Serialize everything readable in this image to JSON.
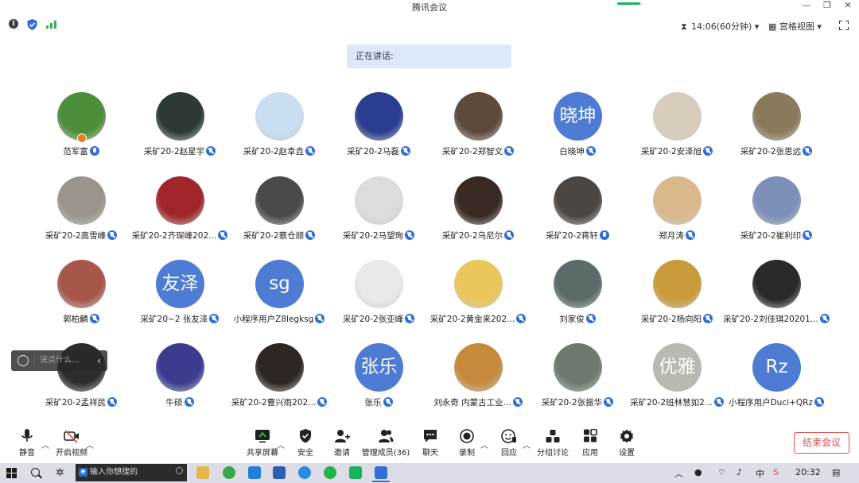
{
  "window": {
    "title": "腾讯会议",
    "controls": [
      "—",
      "❐",
      "✕"
    ],
    "progress_fraction": 0.9
  },
  "topbar": {
    "timer": "14:06(60分钟)",
    "view_mode": "宫格视图"
  },
  "speaking_label": "正在讲话:",
  "participants": [
    {
      "name": "范军富",
      "avatar_text": "",
      "color": "#4d8e3b",
      "host": true,
      "mic": "on"
    },
    {
      "name": "采矿20-2赵星宇",
      "avatar_text": "",
      "color": "#2c3a33",
      "host": false,
      "mic": "off"
    },
    {
      "name": "采矿20-2赵幸垚",
      "avatar_text": "",
      "color": "#c9def0",
      "host": false,
      "mic": "off"
    },
    {
      "name": "采矿20-2马磊",
      "avatar_text": "",
      "color": "#2a3d8f",
      "host": false,
      "mic": "off"
    },
    {
      "name": "采矿20-2郑智文",
      "avatar_text": "",
      "color": "#5e4a3c",
      "host": false,
      "mic": "off"
    },
    {
      "name": "白晓坤",
      "avatar_text": "晓坤",
      "color": "#4e7bd3",
      "host": false,
      "mic": "off"
    },
    {
      "name": "采矿20-2安泽旭",
      "avatar_text": "",
      "color": "#d7cdbd",
      "host": false,
      "mic": "off"
    },
    {
      "name": "采矿20-2张思远",
      "avatar_text": "",
      "color": "#8a7a5c",
      "host": false,
      "mic": "off"
    },
    {
      "name": "采矿20-2高雪峰",
      "avatar_text": "",
      "color": "#9a948c",
      "host": false,
      "mic": "off"
    },
    {
      "name": "采矿20-2齐琛峰202...",
      "avatar_text": "",
      "color": "#a0262c",
      "host": false,
      "mic": "off"
    },
    {
      "name": "采矿20-2蔡仓顺",
      "avatar_text": "",
      "color": "#4a4a48",
      "host": false,
      "mic": "off"
    },
    {
      "name": "采矿20-2马望珣",
      "avatar_text": "",
      "color": "#dcdcd8",
      "host": false,
      "mic": "off"
    },
    {
      "name": "采矿20-2乌尼尔",
      "avatar_text": "",
      "color": "#3a2a24",
      "host": false,
      "mic": "off"
    },
    {
      "name": "采矿20-2蒋轩",
      "avatar_text": "",
      "color": "#4c4642",
      "host": false,
      "mic": "on"
    },
    {
      "name": "郑月涛",
      "avatar_text": "",
      "color": "#d9b88c",
      "host": false,
      "mic": "off"
    },
    {
      "name": "采矿20-2崔利印",
      "avatar_text": "",
      "color": "#7b8fb8",
      "host": false,
      "mic": "off"
    },
    {
      "name": "郭柏麟",
      "avatar_text": "",
      "color": "#a6574a",
      "host": false,
      "mic": "off"
    },
    {
      "name": "采矿20~2 张友泽",
      "avatar_text": "友泽",
      "color": "#4e7bd3",
      "host": false,
      "mic": "off"
    },
    {
      "name": "小程序用户Z8legksg",
      "avatar_text": "sg",
      "color": "#4e7bd3",
      "host": false,
      "mic": "off"
    },
    {
      "name": "采矿20-2张亚峰",
      "avatar_text": "",
      "color": "#e9e9e9",
      "host": false,
      "mic": "off"
    },
    {
      "name": "采矿20-2黄金来202...",
      "avatar_text": "",
      "color": "#e9c65a",
      "host": false,
      "mic": "off"
    },
    {
      "name": "刘家俊",
      "avatar_text": "",
      "color": "#5b6b6a",
      "host": false,
      "mic": "off"
    },
    {
      "name": "采矿20-2杨向阳",
      "avatar_text": "",
      "color": "#c89a3a",
      "host": false,
      "mic": "off"
    },
    {
      "name": "采矿20-2刘佳琪20201...",
      "avatar_text": "",
      "color": "#2a2a2a",
      "host": false,
      "mic": "off"
    },
    {
      "name": "采矿20-2孟祥民",
      "avatar_text": "",
      "color": "#2d2d2d",
      "host": false,
      "mic": "off"
    },
    {
      "name": "牛硕",
      "avatar_text": "",
      "color": "#3b3c8f",
      "host": false,
      "mic": "off"
    },
    {
      "name": "采矿20-2曹兴雨202...",
      "avatar_text": "",
      "color": "#2e2622",
      "host": false,
      "mic": "off"
    },
    {
      "name": "张乐",
      "avatar_text": "张乐",
      "color": "#4e7bd3",
      "host": false,
      "mic": "off"
    },
    {
      "name": "刘永奇 内蒙古工业...",
      "avatar_text": "",
      "color": "#c58a3c",
      "host": false,
      "mic": "off"
    },
    {
      "name": "采矿20-2张振华",
      "avatar_text": "",
      "color": "#6d7a70",
      "host": false,
      "mic": "off"
    },
    {
      "name": "采矿20-2班林慧如2...",
      "avatar_text": "优雅",
      "color": "#b9b9b2",
      "host": false,
      "mic": "off"
    },
    {
      "name": "小程序用户Duci+QRz",
      "avatar_text": "Rz",
      "color": "#4e7bd3",
      "host": false,
      "mic": "off"
    }
  ],
  "chat": {
    "placeholder": "说点什么..."
  },
  "toolbar": {
    "mute": "静音",
    "video": "开启视频",
    "share": "共享屏幕",
    "security": "安全",
    "invite": "邀请",
    "members": "管理成员(36)",
    "chat": "聊天",
    "record": "录制",
    "reaction": "回应",
    "breakout": "分组讨论",
    "apps": "应用",
    "settings": "设置",
    "end": "结束会议"
  },
  "taskbar": {
    "search_placeholder": "输入你想搜的",
    "input_method": "中",
    "time": "20:32"
  },
  "colors": {
    "accent": "#2f6fd6",
    "avatar_blue": "#4e7bd3",
    "danger": "#e34d4d",
    "speaking_bg": "#dce9fb"
  }
}
